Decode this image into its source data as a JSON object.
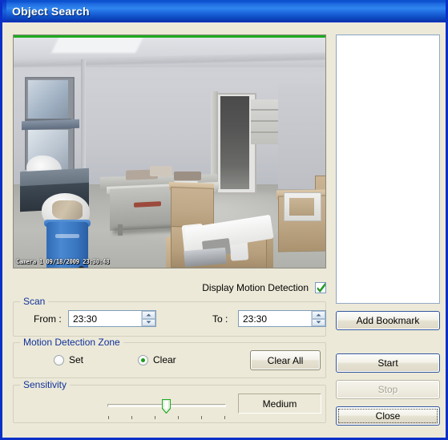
{
  "window": {
    "title": "Object Search",
    "title_bar_color": "#1f6be0",
    "body_color": "#ece9d8",
    "border_color": "#0a30c8"
  },
  "video": {
    "name": "camera-preview",
    "osd_timestamp": "Camera 1  09/18/2009  23:30:48",
    "motion_zone_border_color": "#1faa21",
    "scene_description": "Indoor storage room with blue recycling bin, cardboard boxes, styrofoam packing and open doorway"
  },
  "bookmark_list": {
    "name": "bookmark-listbox",
    "items": [],
    "background": "#ffffff",
    "border_color": "#93a9c4"
  },
  "display_motion_detection": {
    "label": "Display Motion Detection",
    "checked": true,
    "check_color": "#1faa21"
  },
  "scan": {
    "legend": "Scan",
    "from_label": "From :",
    "from_value": "23:30",
    "to_label": "To :",
    "to_value": "23:30"
  },
  "motion_detection_zone": {
    "legend": "Motion Detection Zone",
    "set_label": "Set",
    "set_checked": false,
    "clear_label": "Clear",
    "clear_checked": true,
    "clear_all_label": "Clear All",
    "radio_dot_color": "#1a9c1a"
  },
  "sensitivity": {
    "legend": "Sensitivity",
    "value_label": "Medium",
    "tick_count": 6,
    "position_index": 3,
    "thumb_color": "#1faa21"
  },
  "actions": {
    "add_bookmark": "Add Bookmark",
    "start": "Start",
    "stop": "Stop",
    "stop_enabled": false,
    "close": "Close",
    "close_focused": true
  }
}
